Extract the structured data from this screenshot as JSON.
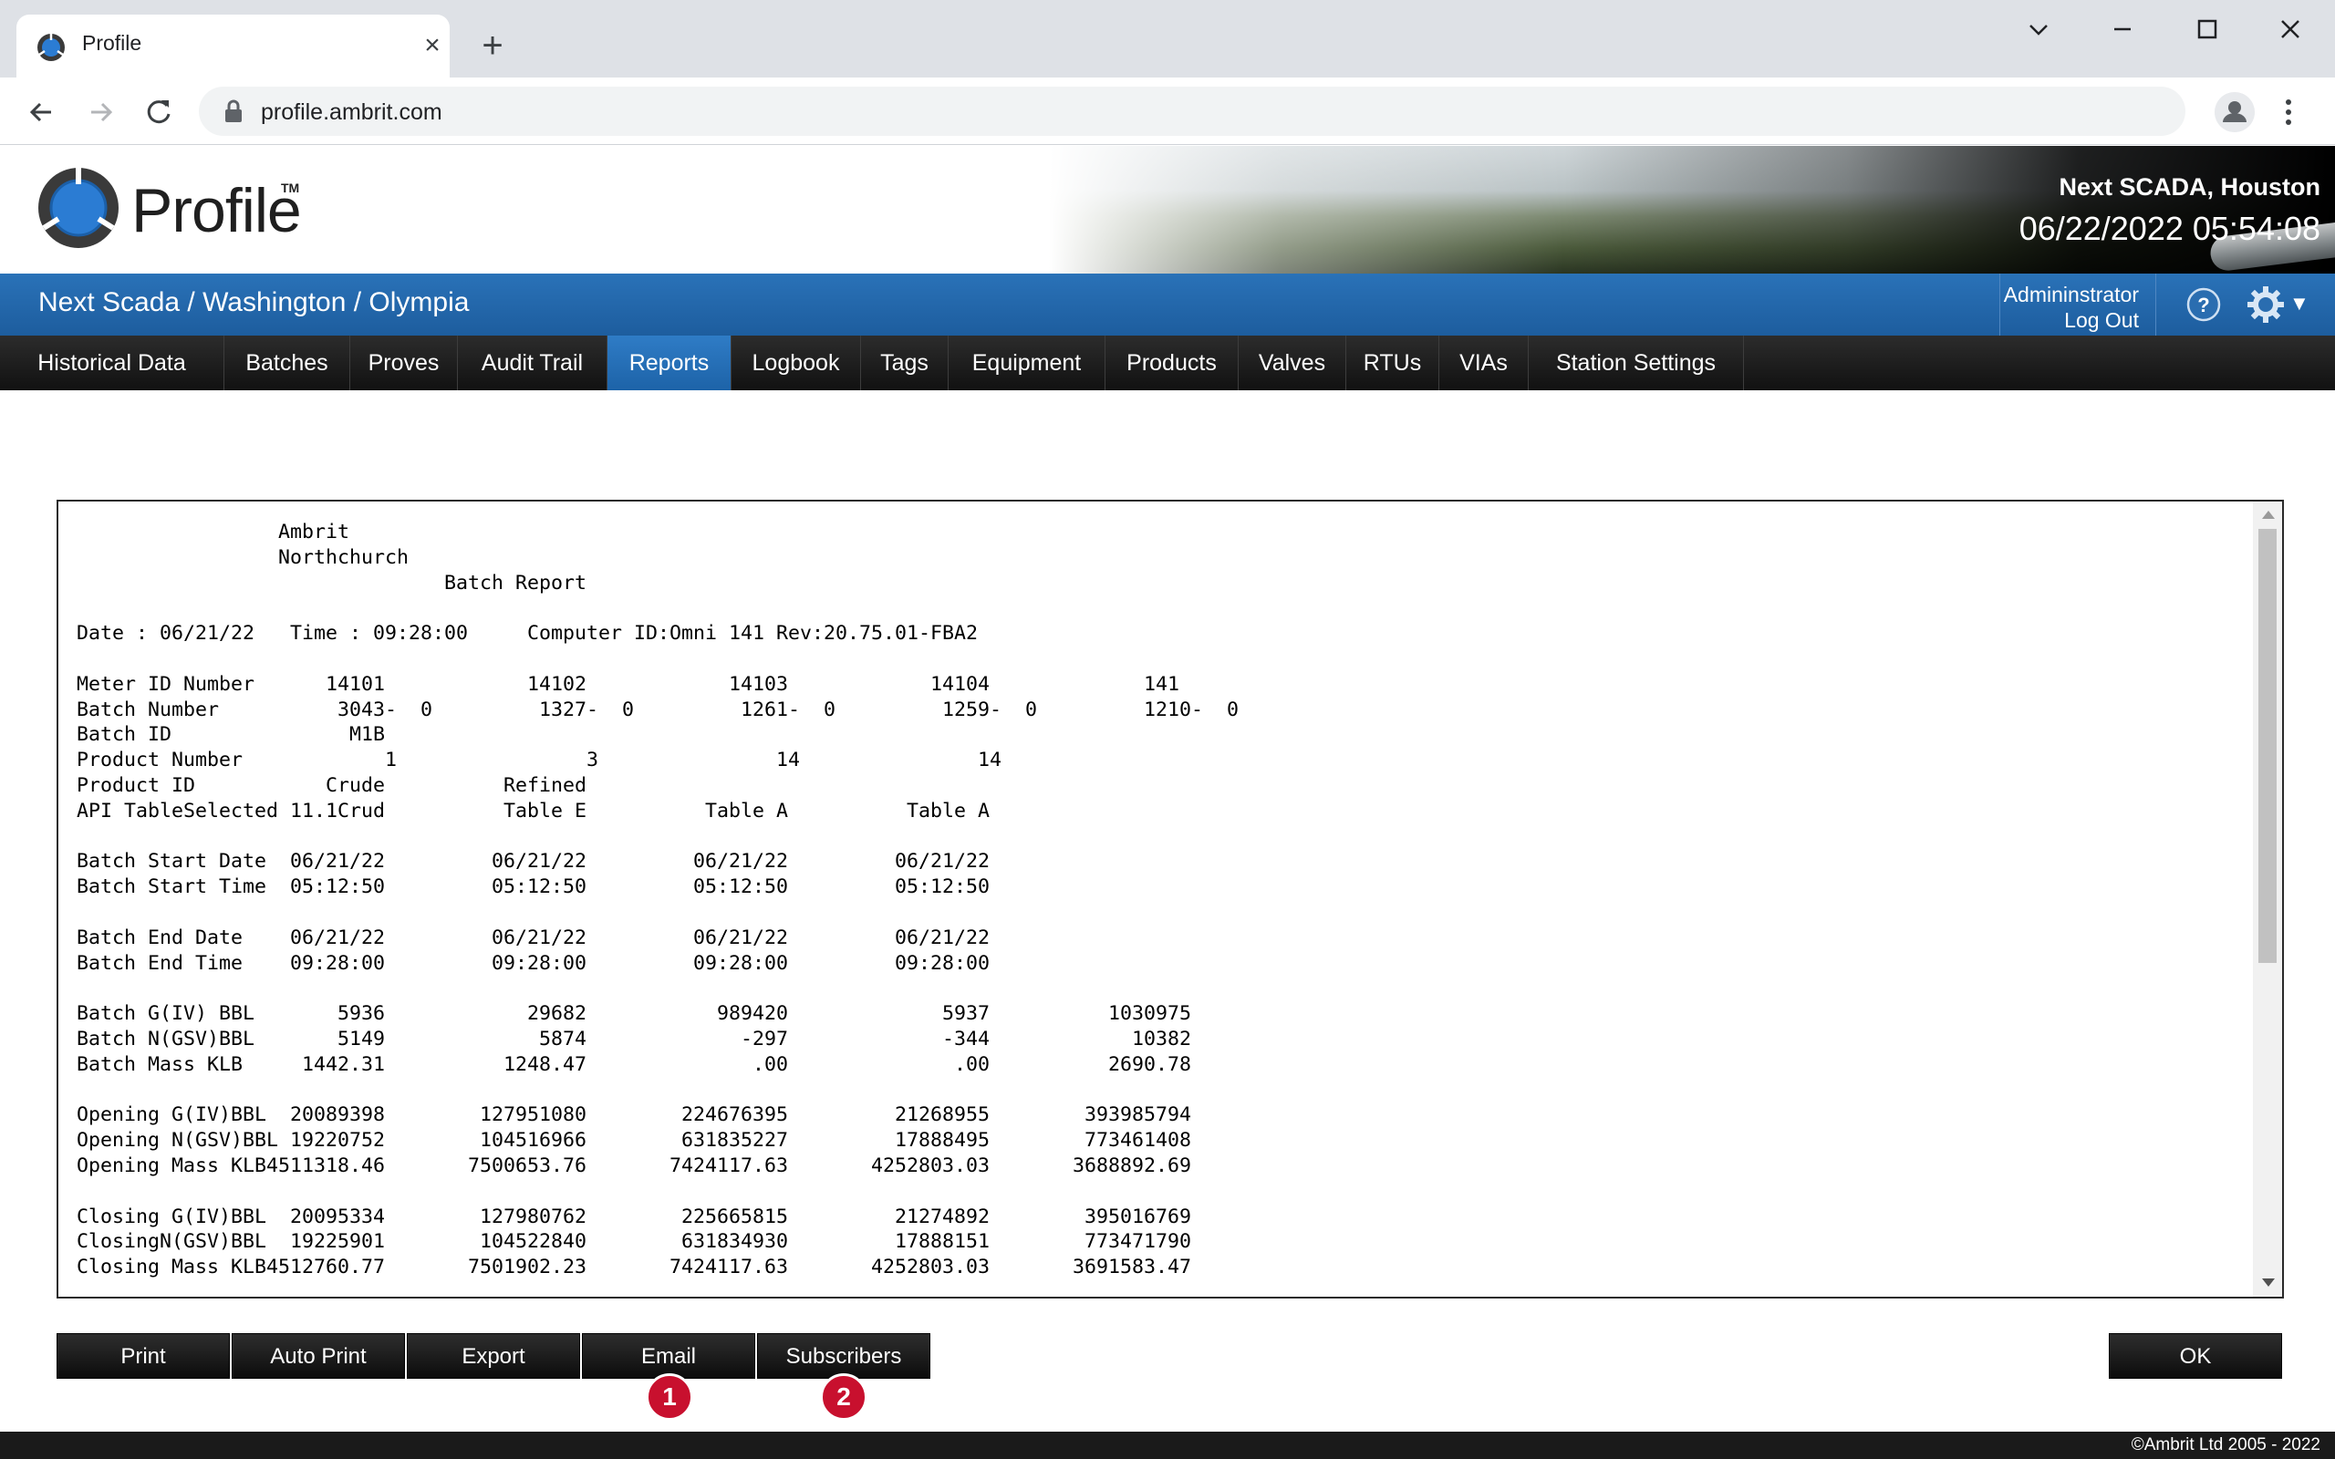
{
  "browser": {
    "tab_title": "Profile",
    "url": "profile.ambrit.com"
  },
  "header": {
    "logo_text": "Profile",
    "logo_tm": "TM",
    "site_name": "Next SCADA, Houston",
    "datetime": "06/22/2022 05:54:08"
  },
  "bluebar": {
    "breadcrumb": "Next Scada / Washington / Olympia",
    "user": "Admininstrator",
    "logout": "Log Out"
  },
  "menu": {
    "active": "Reports",
    "items": [
      "Historical Data",
      "Batches",
      "Proves",
      "Audit Trail",
      "Reports",
      "Logbook",
      "Tags",
      "Equipment",
      "Products",
      "Valves",
      "RTUs",
      "VIAs",
      "Station Settings"
    ]
  },
  "report": {
    "lines": [
      "                 Ambrit",
      "                 Northchurch",
      "                               Batch Report",
      "",
      "Date : 06/21/22   Time : 09:28:00     Computer ID:Omni 141 Rev:20.75.01-FBA2",
      "",
      "Meter ID Number      14101            14102            14103            14104             141",
      "Batch Number          3043-  0         1327-  0         1261-  0         1259-  0         1210-  0",
      "Batch ID               M1B",
      "Product Number            1                3               14               14",
      "Product ID           Crude          Refined",
      "API TableSelected 11.1Crud          Table E          Table A          Table A",
      "",
      "Batch Start Date  06/21/22         06/21/22         06/21/22         06/21/22",
      "Batch Start Time  05:12:50         05:12:50         05:12:50         05:12:50",
      "",
      "Batch End Date    06/21/22         06/21/22         06/21/22         06/21/22",
      "Batch End Time    09:28:00         09:28:00         09:28:00         09:28:00",
      "",
      "Batch G(IV) BBL       5936            29682           989420             5937          1030975",
      "Batch N(GSV)BBL       5149             5874             -297             -344            10382",
      "Batch Mass KLB     1442.31          1248.47              .00              .00          2690.78",
      "",
      "Opening G(IV)BBL  20089398        127951080        224676395         21268955        393985794",
      "Opening N(GSV)BBL 19220752        104516966        631835227         17888495        773461408",
      "Opening Mass KLB4511318.46       7500653.76       7424117.63       4252803.03       3688892.69",
      "",
      "Closing G(IV)BBL  20095334        127980762        225665815         21274892        395016769",
      "ClosingN(GSV)BBL  19225901        104522840        631834930         17888151        773471790",
      "Closing Mass KLB4512760.77       7501902.23       7424117.63       4252803.03       3691583.47"
    ]
  },
  "actions": {
    "print": "Print",
    "auto_print": "Auto Print",
    "export": "Export",
    "email": "Email",
    "subscribers": "Subscribers",
    "ok": "OK",
    "callout_1": "1",
    "callout_2": "2"
  },
  "footer": {
    "copyright": "©Ambrit Ltd 2005 - 2022"
  },
  "colors": {
    "brand_blue": "#1d5d9e",
    "active_tab": "#2f7cc6",
    "callout_red": "#c8102e"
  },
  "icons": [
    "profile-logo-icon",
    "back-arrow-icon",
    "forward-arrow-icon",
    "reload-icon",
    "lock-icon",
    "account-icon",
    "kebab-menu-icon",
    "help-icon",
    "gear-icon",
    "close-icon",
    "plus-icon",
    "minimize-icon",
    "maximize-icon"
  ]
}
